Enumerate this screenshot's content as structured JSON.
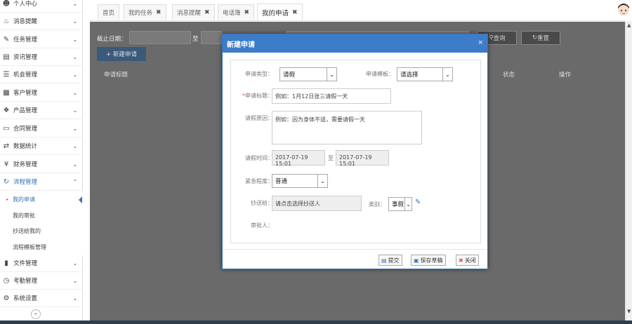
{
  "sidebar": {
    "items": [
      {
        "label": "个人中心",
        "icon": "user-icon"
      },
      {
        "label": "消息提醒",
        "icon": "bell-icon"
      },
      {
        "label": "任务管理",
        "icon": "edit-icon"
      },
      {
        "label": "资讯管理",
        "icon": "file-icon"
      },
      {
        "label": "机会管理",
        "icon": "list-icon"
      },
      {
        "label": "客户管理",
        "icon": "users-icon"
      },
      {
        "label": "产品管理",
        "icon": "cubes-icon"
      },
      {
        "label": "合同管理",
        "icon": "folder-icon"
      },
      {
        "label": "数据统计",
        "icon": "shuffle-icon"
      },
      {
        "label": "财务管理",
        "icon": "yen-icon"
      },
      {
        "label": "流程管理",
        "icon": "workflow-icon"
      }
    ],
    "sub_items": [
      "我的申请",
      "我的审批",
      "抄送给我的",
      "流程模板管理"
    ],
    "items_after": [
      {
        "label": "文件管理",
        "icon": "document-icon"
      },
      {
        "label": "考勤管理",
        "icon": "clock-icon"
      },
      {
        "label": "系统设置",
        "icon": "settings-icon"
      }
    ],
    "collapse": "«"
  },
  "tabs": [
    {
      "label": "首页",
      "closable": false
    },
    {
      "label": "我的任务",
      "closable": true
    },
    {
      "label": "消息提醒",
      "closable": true
    },
    {
      "label": "电话簿",
      "closable": true
    },
    {
      "label": "我的申请",
      "closable": true
    }
  ],
  "toolbar": {
    "date_label": "截止日期：",
    "date_sep": "至",
    "search_label": "查询",
    "reset_label": "重置",
    "new_label": "+ 新建申请"
  },
  "grid": {
    "columns": [
      "申请标题",
      "状态",
      "操作"
    ]
  },
  "modal": {
    "title": "新建申请",
    "close": "×",
    "fields": {
      "type_label": "申请类型：",
      "type_value": "请假",
      "template_label": "申请模板：",
      "template_value": "请选择",
      "title_label": "申请标题：",
      "title_placeholder": "例如：1月12日张三请假一天",
      "reason_label": "请假原因：",
      "reason_placeholder": "例如：因为身体不适，需要请假一天",
      "time_label": "请假时间：",
      "time_start": "2017-07-19 15:01",
      "time_sep": "至",
      "time_end": "2017-07-19 15:01",
      "urgency_label": "紧急程度：",
      "urgency_value": "普通",
      "cc_label": "抄送给：",
      "cc_placeholder": "请点击选择抄送人",
      "category_label": "类别：",
      "category_value": "事假",
      "approver_label": "审批人："
    },
    "buttons": {
      "submit": "提交",
      "save_draft": "保存草稿",
      "close": "关闭"
    }
  },
  "colors": {
    "accent": "#3d7cc9",
    "required": "#d9534f"
  }
}
